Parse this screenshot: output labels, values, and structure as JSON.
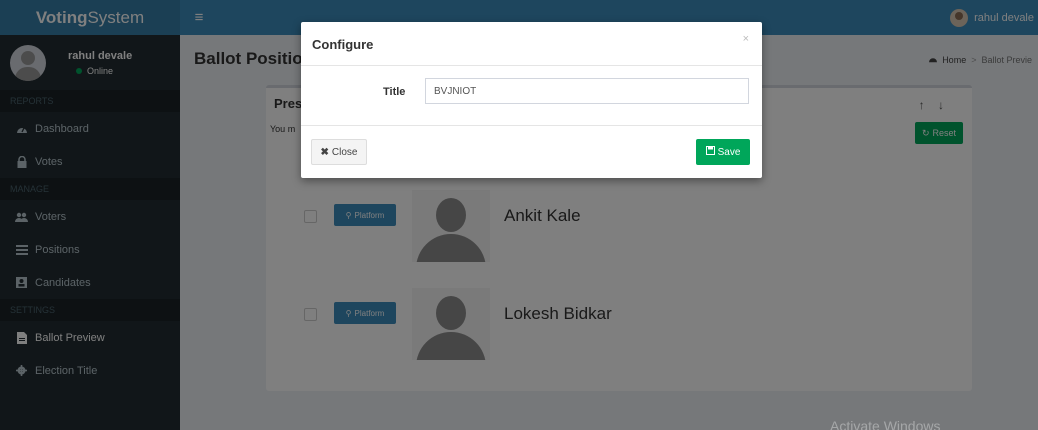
{
  "brand": {
    "bold": "Voting",
    "rest": "System"
  },
  "topbar": {
    "menu_icon": "hamburger-icon",
    "user_name": "rahul devale"
  },
  "sidebar": {
    "user": {
      "name": "rahul devale",
      "status": "Online"
    },
    "sections": [
      {
        "header": "REPORTS",
        "items": [
          {
            "label": "Dashboard",
            "icon": "dashboard-icon"
          },
          {
            "label": "Votes",
            "icon": "lock-icon"
          }
        ]
      },
      {
        "header": "MANAGE",
        "items": [
          {
            "label": "Voters",
            "icon": "users-icon"
          },
          {
            "label": "Positions",
            "icon": "tasks-icon"
          },
          {
            "label": "Candidates",
            "icon": "candidate-icon"
          }
        ]
      },
      {
        "header": "SETTINGS",
        "items": [
          {
            "label": "Ballot Preview",
            "icon": "file-icon"
          },
          {
            "label": "Election Title",
            "icon": "cog-icon"
          }
        ]
      }
    ]
  },
  "page": {
    "title": "Ballot Positio"
  },
  "breadcrumb": {
    "home": "Home",
    "current": "Ballot Previe"
  },
  "box": {
    "title": "Pres",
    "instruction": "You m",
    "reset_label": "Reset",
    "candidates": [
      {
        "name": "Ankit Kale",
        "platform_label": "Platform"
      },
      {
        "name": "Lokesh Bidkar",
        "platform_label": "Platform"
      }
    ]
  },
  "modal": {
    "title": "Configure",
    "close_x": "×",
    "field_label": "Title",
    "field_value": "BVJNIOT",
    "close_label": "Close",
    "save_label": "Save"
  },
  "watermark": "Activate Windows"
}
